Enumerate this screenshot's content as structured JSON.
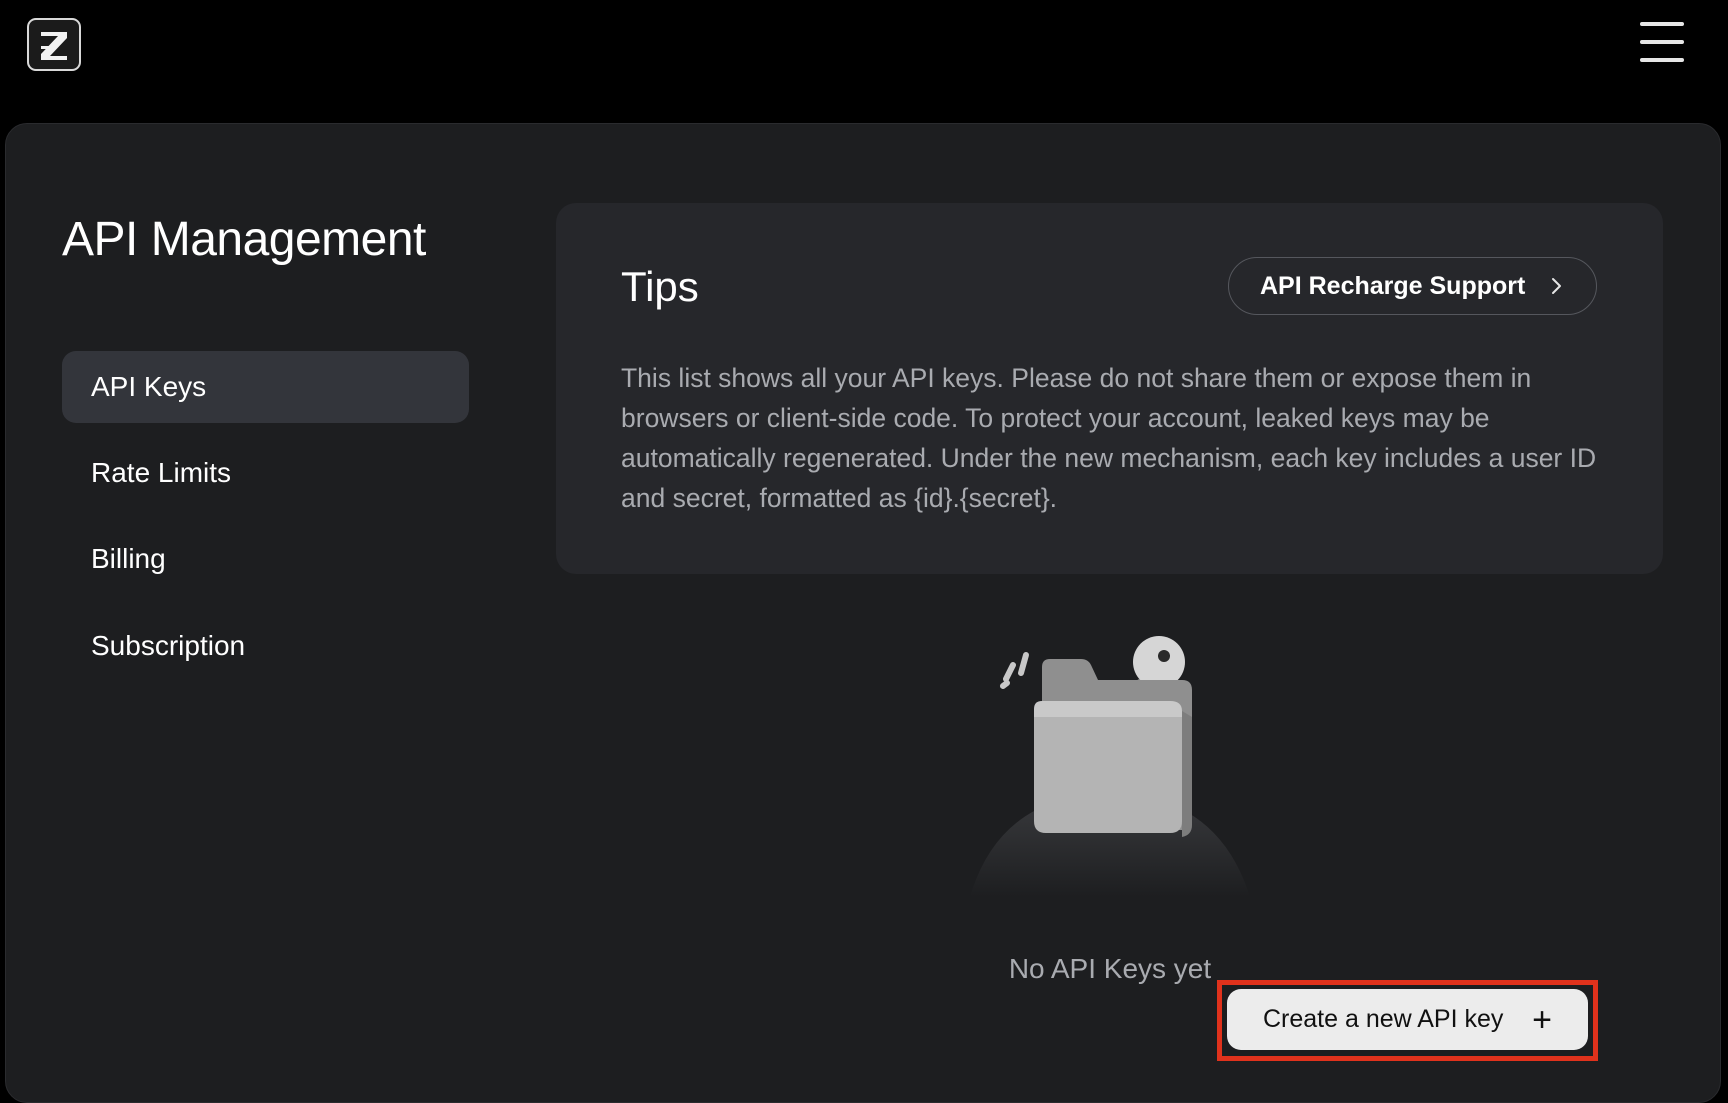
{
  "header": {
    "logo_icon": "z-logo-icon",
    "menu_icon": "hamburger-menu-icon"
  },
  "page": {
    "title": "API Management"
  },
  "sidebar": {
    "items": [
      {
        "label": "API Keys",
        "active": true
      },
      {
        "label": "Rate Limits",
        "active": false
      },
      {
        "label": "Billing",
        "active": false
      },
      {
        "label": "Subscription",
        "active": false
      }
    ]
  },
  "tips": {
    "title": "Tips",
    "recharge_button": "API Recharge Support",
    "recharge_icon": "chevron-right-icon",
    "body": "This list shows all your API keys. Please do not share them or expose them in browsers or client-side code. To protect your account, leaked keys may be automatically regenerated. Under the new mechanism, each key includes a user ID and secret, formatted as {id}.{secret}."
  },
  "empty_state": {
    "illustration_icon": "folder-key-icon",
    "message": "No API Keys yet",
    "create_button": "Create a new API key",
    "create_icon": "plus-icon"
  },
  "colors": {
    "background": "#000000",
    "panel": "#1d1e20",
    "card": "#26272b",
    "active_nav": "#33353b",
    "highlight_outline": "#e0321c",
    "muted_text": "#a9abb0"
  }
}
